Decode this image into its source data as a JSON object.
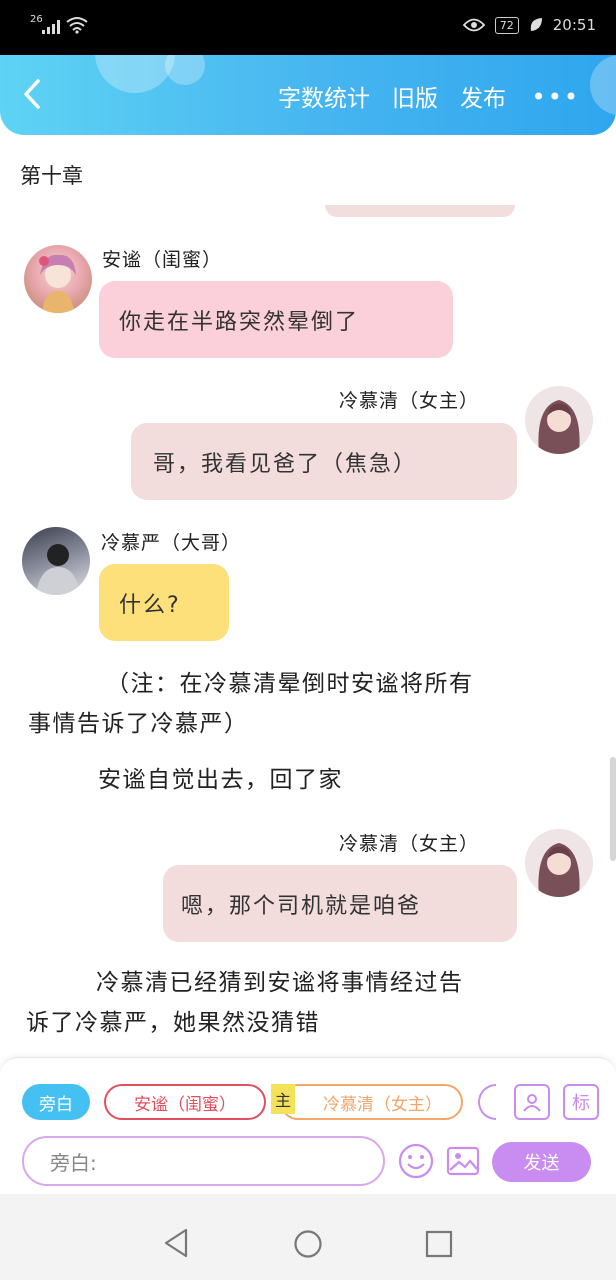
{
  "status": {
    "network": "26",
    "battery": "72",
    "time": "20:51"
  },
  "header": {
    "actions": [
      "字数统计",
      "旧版",
      "发布"
    ],
    "more": "•••"
  },
  "chapter_title": "第十章",
  "messages": [
    {
      "speaker": "安谧（闺蜜）",
      "text": "你走在半路突然晕倒了",
      "side": "left",
      "color": "#fbd0db"
    },
    {
      "speaker": "冷慕清（女主）",
      "text": "哥，我看见爸了（焦急）",
      "side": "right",
      "color": "#f3dcdc"
    },
    {
      "speaker": "冷慕严（大哥）",
      "text": "什么?",
      "side": "left",
      "color": "#fde07a"
    },
    {
      "speaker": "冷慕清（女主）",
      "text": "嗯，那个司机就是咱爸",
      "side": "right",
      "color": "#f3dcdc"
    }
  ],
  "narration": [
    {
      "line1": "（注：在冷慕清晕倒时安谧将所有",
      "line2": "事情告诉了冷慕严）"
    },
    {
      "line1": "安谧自觉出去，回了家"
    },
    {
      "line1": "冷慕清已经猜到安谧将事情经过告",
      "line2": "诉了冷慕严，她果然没猜错"
    }
  ],
  "composer": {
    "chips": {
      "aside": "旁白",
      "friend": "安谧（闺蜜）",
      "main_badge": "主",
      "heroine": "冷慕清（女主）"
    },
    "input_placeholder": "旁白:",
    "send": "发送",
    "mark_icon_label": "标"
  },
  "colors": {
    "header_gradient_start": "#5fd3f4",
    "header_gradient_end": "#2fa6ee",
    "send_button": "#c98cf0",
    "aside_chip": "#45c0f2"
  }
}
